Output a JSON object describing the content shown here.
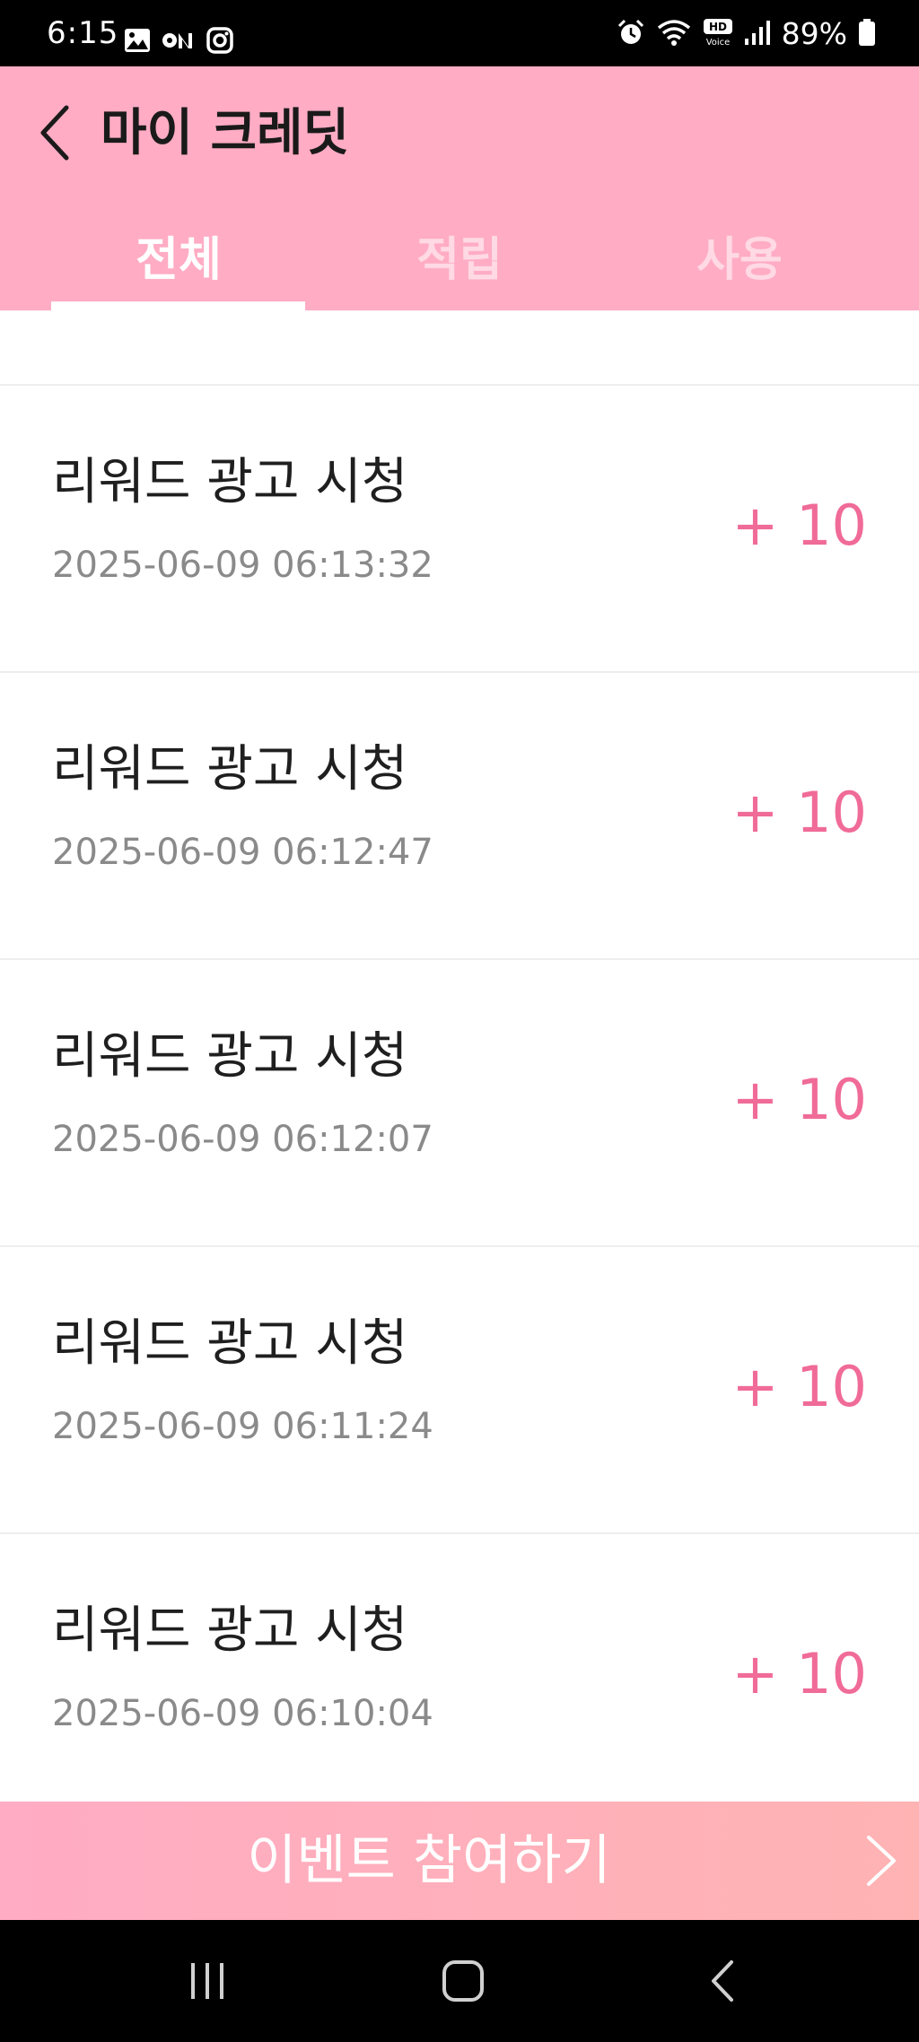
{
  "status_bar": {
    "time": "6:15",
    "battery": "89%",
    "left_icons": [
      "gallery-icon",
      "on-icon",
      "instagram-icon"
    ],
    "right_icons": [
      "alarm-icon",
      "wifi-icon",
      "hd-voice-icon",
      "signal-icon",
      "battery-icon"
    ]
  },
  "header": {
    "title": "마이 크레딧",
    "back_icon": "chevron-left-icon",
    "background_color": "#ffacc4"
  },
  "tabs": [
    {
      "label": "전체",
      "active": true
    },
    {
      "label": "적립",
      "active": false
    },
    {
      "label": "사용",
      "active": false
    }
  ],
  "credit_history": [
    {
      "title": "리워드 광고 시청",
      "datetime": "2025-06-09 06:13:32",
      "amount": "+ 10"
    },
    {
      "title": "리워드 광고 시청",
      "datetime": "2025-06-09 06:12:47",
      "amount": "+ 10"
    },
    {
      "title": "리워드 광고 시청",
      "datetime": "2025-06-09 06:12:07",
      "amount": "+ 10"
    },
    {
      "title": "리워드 광고 시청",
      "datetime": "2025-06-09 06:11:24",
      "amount": "+ 10"
    },
    {
      "title": "리워드 광고 시청",
      "datetime": "2025-06-09 06:10:04",
      "amount": "+ 10"
    }
  ],
  "event_bar": {
    "label": "이벤트 참여하기",
    "arrow_icon": "chevron-right-icon"
  },
  "colors": {
    "accent_pink": "#ffacc4",
    "amount_pink": "#f06b98"
  },
  "nav_bar": {
    "buttons": [
      "recent-apps-icon",
      "home-icon",
      "back-icon"
    ]
  }
}
